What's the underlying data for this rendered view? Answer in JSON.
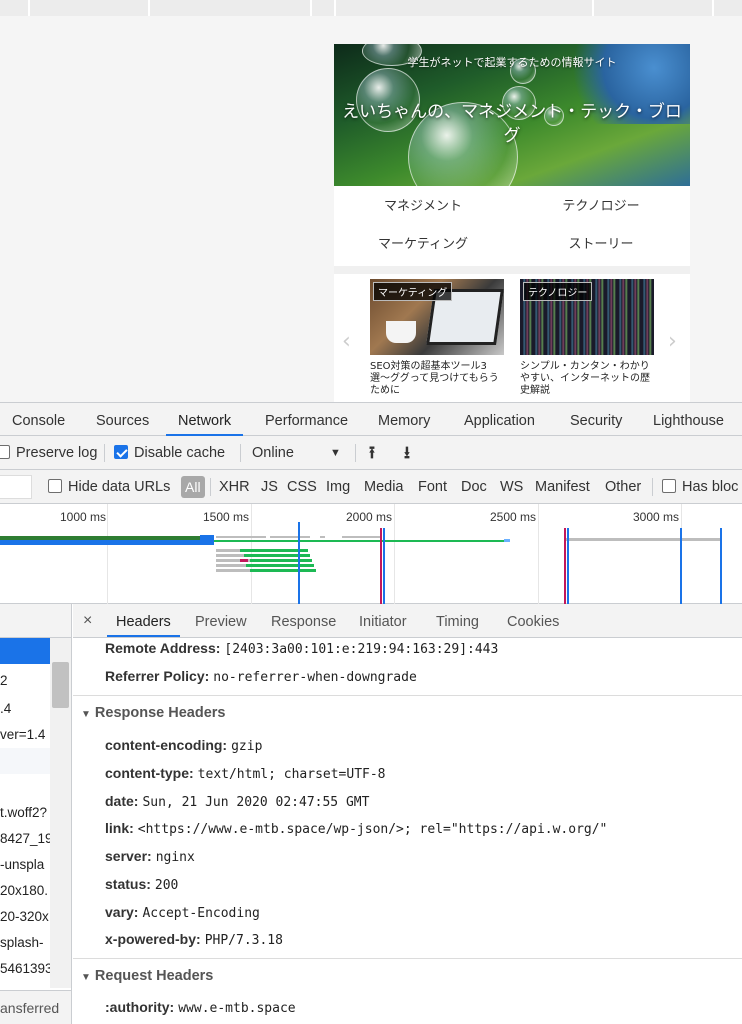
{
  "site": {
    "tagline": "学生がネットで起業するための情報サイト",
    "title": "えいちゃんの、マネジメント・テック・ブログ",
    "categories": [
      "マネジメント",
      "テクノロジー",
      "マーケティング",
      "ストーリー"
    ],
    "cards": [
      {
        "badge": "マーケティング",
        "title": "SEO対策の超基本ツール3選〜ググって見つけてもらうために"
      },
      {
        "badge": "テクノロジー",
        "title": "シンプル・カンタン・わかりやすい、インターネットの歴史解説"
      }
    ],
    "prev_arrow": "‹",
    "next_arrow": "›"
  },
  "devtools": {
    "tabs": [
      "Console",
      "Sources",
      "Network",
      "Performance",
      "Memory",
      "Application",
      "Security",
      "Lighthouse"
    ],
    "active_tab": "Network",
    "toolbar": {
      "preserve_log": "Preserve log",
      "disable_cache": "Disable cache",
      "throttle": "Online",
      "dropdown": "▼",
      "upload": "⭱",
      "download": "⭳"
    },
    "filters": [
      "Hide data URLs",
      "All",
      "XHR",
      "JS",
      "CSS",
      "Img",
      "Media",
      "Font",
      "Doc",
      "WS",
      "Manifest",
      "Other",
      "Has bloc"
    ],
    "timeline_labels": [
      "1000 ms",
      "1500 ms",
      "2000 ms",
      "2500 ms",
      "3000 ms"
    ],
    "requests": [
      "",
      "2",
      ".4",
      "ver=1.4",
      "",
      "t.woff2?",
      "8427_19",
      "-unspla",
      "20x180.",
      "20-320x",
      "splash-",
      "5461393"
    ],
    "status_text": "ansferred",
    "detail_tabs": [
      "Headers",
      "Preview",
      "Response",
      "Initiator",
      "Timing",
      "Cookies"
    ],
    "close": "×",
    "general": [
      {
        "key": "Remote Address:",
        "value": "[2403:3a00:101:e:219:94:163:29]:443"
      },
      {
        "key": "Referrer Policy:",
        "value": "no-referrer-when-downgrade"
      }
    ],
    "response_title": "Response Headers",
    "response_headers": [
      {
        "key": "content-encoding:",
        "value": "gzip"
      },
      {
        "key": "content-type:",
        "value": "text/html; charset=UTF-8"
      },
      {
        "key": "date:",
        "value": "Sun, 21 Jun 2020 02:47:55 GMT"
      },
      {
        "key": "link:",
        "value": "<https://www.e-mtb.space/wp-json/>; rel=\"https://api.w.org/\""
      },
      {
        "key": "server:",
        "value": "nginx"
      },
      {
        "key": "status:",
        "value": "200"
      },
      {
        "key": "vary:",
        "value": "Accept-Encoding"
      },
      {
        "key": "x-powered-by:",
        "value": "PHP/7.3.18"
      }
    ],
    "request_title": "Request Headers",
    "request_headers": [
      {
        "key": ":authority:",
        "value": "www.e-mtb.space"
      }
    ]
  }
}
